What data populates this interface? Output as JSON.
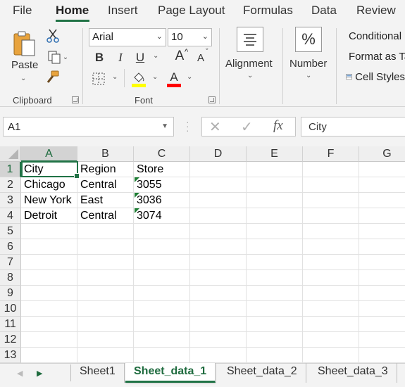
{
  "ribbon_tabs": [
    {
      "label": "File"
    },
    {
      "label": "Home"
    },
    {
      "label": "Insert"
    },
    {
      "label": "Page Layout"
    },
    {
      "label": "Formulas"
    },
    {
      "label": "Data"
    },
    {
      "label": "Review"
    }
  ],
  "active_tab": "Home",
  "clipboard": {
    "paste_label": "Paste",
    "group_label": "Clipboard"
  },
  "font": {
    "family": "Arial",
    "size": "10",
    "group_label": "Font",
    "bold_label": "B",
    "italic_label": "I",
    "underline_label": "U",
    "grow_label": "A",
    "shrink_label": "A",
    "font_color_label": "A",
    "fill_color_hex": "#ffff00",
    "font_color_hex": "#ff0000"
  },
  "alignment": {
    "label": "Alignment"
  },
  "number": {
    "label": "Number",
    "icon_glyph": "%"
  },
  "styles": {
    "conditional_label": "Conditional Formatting",
    "format_table_label": "Format as Table",
    "cell_styles_label": "Cell Styles"
  },
  "formula_bar": {
    "name_box": "A1",
    "content": "City",
    "fx_label": "fx"
  },
  "grid": {
    "columns": [
      "A",
      "B",
      "C",
      "D",
      "E",
      "F",
      "G"
    ],
    "rows": [
      "1",
      "2",
      "3",
      "4",
      "5",
      "6",
      "7",
      "8",
      "9",
      "10",
      "11",
      "12",
      "13"
    ],
    "data": [
      [
        "City",
        "Region",
        "Store"
      ],
      [
        "Chicago",
        "Central",
        "3055"
      ],
      [
        "New York",
        "East",
        "3036"
      ],
      [
        "Detroit",
        "Central",
        "3074"
      ]
    ]
  },
  "sheets": [
    {
      "label": "Sheet1"
    },
    {
      "label": "Sheet_data_1"
    },
    {
      "label": "Sheet_data_2"
    },
    {
      "label": "Sheet_data_3"
    }
  ],
  "active_sheet": "Sheet_data_1",
  "accent_color": "#217346"
}
